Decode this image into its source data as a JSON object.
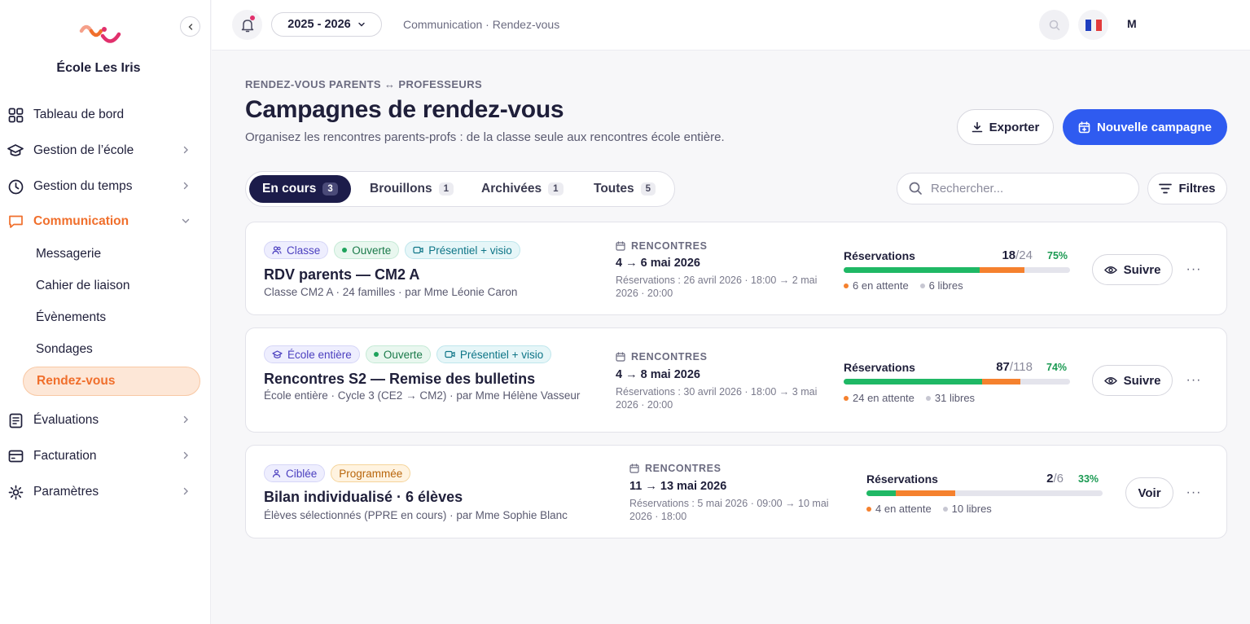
{
  "app": {
    "school_name": "École Les Iris",
    "accent_color": "#f06f2c",
    "primary_color": "#2f5bf0"
  },
  "sidebar": {
    "items": [
      {
        "label": "Tableau de bord",
        "icon": "dashboard-icon"
      },
      {
        "label": "Gestion de l’école",
        "icon": "graduation-cap-icon"
      },
      {
        "label": "Gestion du temps",
        "icon": "clock-icon"
      },
      {
        "label": "Communication",
        "icon": "message-icon"
      },
      {
        "label": "Évaluations",
        "icon": "document-icon"
      },
      {
        "label": "Facturation",
        "icon": "card-icon"
      },
      {
        "label": "Paramètres",
        "icon": "gear-icon"
      }
    ],
    "communication_sub": [
      "Messagerie",
      "Cahier de liaison",
      "Évènements",
      "Sondages",
      "Rendez-vous"
    ]
  },
  "topbar": {
    "year": "2025 - 2026",
    "breadcrumb": "Communication · Rendez-vous",
    "user_initial": "M"
  },
  "page": {
    "eyebrow": "RENDEZ-VOUS PARENTS ↔ PROFESSEURS",
    "title": "Campagnes de rendez-vous",
    "subtitle": "Organisez les rencontres parents-profs : de la classe seule aux rencontres école entière.",
    "export_label": "Exporter",
    "new_label": "Nouvelle campagne"
  },
  "tabs": [
    {
      "label": "En cours",
      "count": "3"
    },
    {
      "label": "Brouillons",
      "count": "1"
    },
    {
      "label": "Archivées",
      "count": "1"
    },
    {
      "label": "Toutes",
      "count": "5"
    }
  ],
  "search": {
    "placeholder": "Rechercher..."
  },
  "filters_label": "Filtres",
  "campaigns": [
    {
      "badges": [
        "Classe",
        "Ouverte",
        "Présentiel + visio"
      ],
      "title": "RDV parents — CM2 A",
      "meta": "Classe CM2 A · 24 familles · par Mme Léonie Caron",
      "rdv_label": "RENCONTRES",
      "dates": "4 → 6 mai 2026",
      "booking": "Réservations : 26 avril 2026 · 18:00 → 2 mai 2026 · 20:00",
      "resa_label": "Réservations",
      "booked": "18",
      "total": "/24",
      "pct": "75%",
      "booked_ratio": 0.6,
      "pending_ratio": 0.2,
      "pending": "6 en attente",
      "free": "6 libres",
      "action": "Suivre"
    },
    {
      "badges": [
        "École entière",
        "Ouverte",
        "Présentiel + visio"
      ],
      "title": "Rencontres S2 — Remise des bulletins",
      "meta": "École entière · Cycle 3 (CE2 → CM2) · par Mme Hélène Vasseur",
      "rdv_label": "RENCONTRES",
      "dates": "4 → 8 mai 2026",
      "booking": "Réservations : 30 avril 2026 · 18:00 → 3 mai 2026 · 20:00",
      "resa_label": "Réservations",
      "booked": "87",
      "total": "/118",
      "pct": "74%",
      "booked_ratio": 0.61,
      "pending_ratio": 0.17,
      "pending": "24 en attente",
      "free": "31 libres",
      "action": "Suivre"
    },
    {
      "badges": [
        "Ciblée",
        "Programmée"
      ],
      "title": "Bilan individualisé · 6 élèves",
      "meta": "Élèves sélectionnés (PPRE en cours) · par Mme Sophie Blanc",
      "rdv_label": "RENCONTRES",
      "dates": "11 → 13 mai 2026",
      "booking": "Réservations : 5 mai 2026 · 09:00 → 10 mai 2026 · 18:00",
      "resa_label": "Réservations",
      "booked": "2",
      "total": "/6",
      "pct": "33%",
      "booked_ratio": 0.125,
      "pending_ratio": 0.25,
      "pending": "4 en attente",
      "free": "10 libres",
      "action": "Voir"
    }
  ]
}
